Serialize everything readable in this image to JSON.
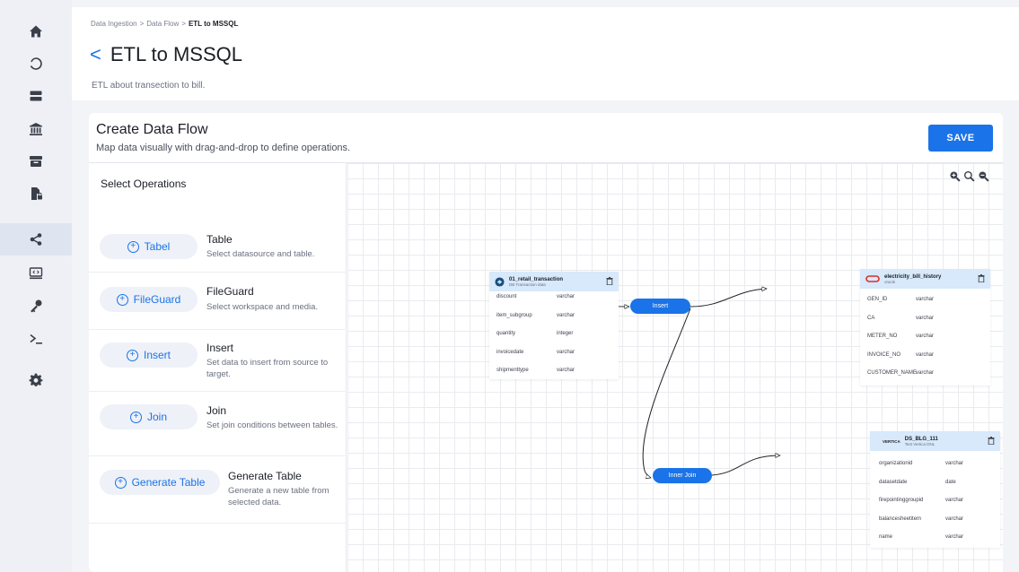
{
  "sidebar": {
    "items": [
      {
        "icon": "home-icon"
      },
      {
        "icon": "circle-icon"
      },
      {
        "icon": "server-icon"
      },
      {
        "icon": "bank-icon"
      },
      {
        "icon": "archive-icon"
      },
      {
        "icon": "file-lock-icon"
      },
      {
        "icon": "share-icon",
        "active": true
      },
      {
        "icon": "code-monitor-icon"
      },
      {
        "icon": "key-icon"
      },
      {
        "icon": "terminal-icon"
      },
      {
        "icon": "gear-icon"
      }
    ]
  },
  "header": {
    "breadcrumb": [
      "Data Ingestion",
      ">",
      "Data Flow",
      ">",
      "ETL to MSSQL"
    ],
    "back": "<",
    "title": "ETL to MSSQL",
    "description": "ETL about transection to bill."
  },
  "card": {
    "title": "Create Data Flow",
    "subtitle": "Map data visually with drag-and-drop to define operations.",
    "save_label": "SAVE"
  },
  "operations": {
    "heading": "Select Operations",
    "items": [
      {
        "button": "Tabel",
        "name": "Table",
        "desc": "Select datasource and table."
      },
      {
        "button": "FileGuard",
        "name": "FileGuard",
        "desc": "Select workspace and media."
      },
      {
        "button": "Insert",
        "name": "Insert",
        "desc": "Set data to insert from source to target."
      },
      {
        "button": "Join",
        "name": "Join",
        "desc": "Set join conditions between tables."
      },
      {
        "button": "Generate Table",
        "name": "Generate Table",
        "desc": "Generate a new table from selected data."
      }
    ]
  },
  "canvas": {
    "zoom_icons": [
      "zoom-in-icon",
      "zoom-reset-icon",
      "zoom-out-icon"
    ],
    "nodes": {
      "source": {
        "title": "01_retail_transaction",
        "subtitle": "DB Transaction data",
        "fields": [
          {
            "name": "discount",
            "type": "varchar"
          },
          {
            "name": "item_subgroup",
            "type": "varchar"
          },
          {
            "name": "quantity",
            "type": "integer"
          },
          {
            "name": "invoicedate",
            "type": "varchar"
          },
          {
            "name": "shipmenttype",
            "type": "varchar"
          }
        ]
      },
      "target1": {
        "title": "electricity_bill_history",
        "subtitle": "oracle",
        "fields": [
          {
            "name": "GEN_ID",
            "type": "varchar"
          },
          {
            "name": "CA",
            "type": "varchar"
          },
          {
            "name": "METER_NO",
            "type": "varchar"
          },
          {
            "name": "INVOICE_NO",
            "type": "varchar"
          },
          {
            "name": "CUSTOMER_NAME",
            "type": "varchar"
          }
        ]
      },
      "target2": {
        "logo": "VERTICA",
        "title": "DS_BLG_111",
        "subtitle": "Test Vertica DNL",
        "fields": [
          {
            "name": "organizationid",
            "type": "varchar"
          },
          {
            "name": "datasetdate",
            "type": "date"
          },
          {
            "name": "firepointinggroupid",
            "type": "varchar"
          },
          {
            "name": "balancesheetitem",
            "type": "varchar"
          },
          {
            "name": "name",
            "type": "varchar"
          }
        ]
      }
    },
    "insert_label": "Insert",
    "join_label": "Inner Join"
  },
  "colors": {
    "accent": "#1a73e8",
    "node_header": "#d7e9fb",
    "oracle_red": "#d9302a"
  }
}
